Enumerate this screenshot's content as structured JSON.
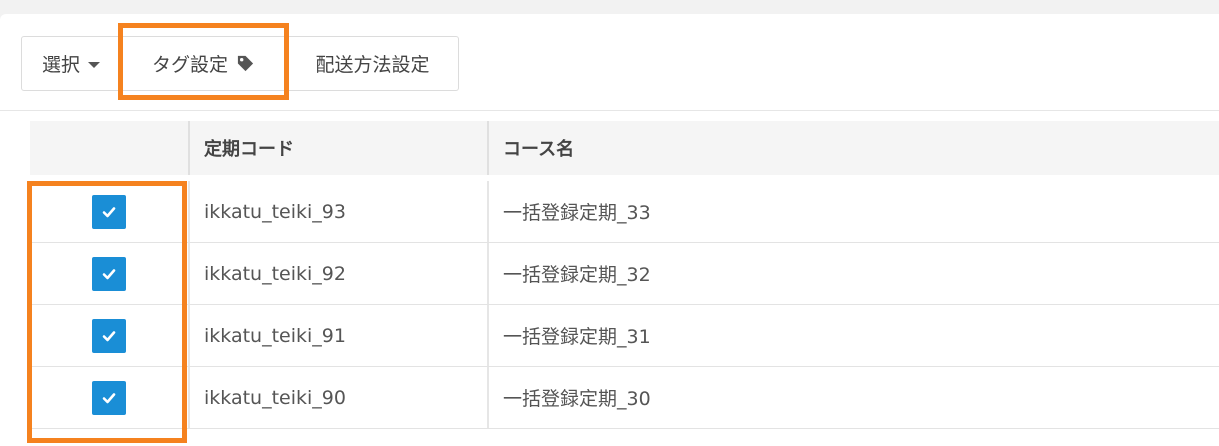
{
  "toolbar": {
    "select_label": "選択",
    "tag_label": "タグ設定",
    "shipping_label": "配送方法設定"
  },
  "table": {
    "headers": [
      "",
      "定期コード",
      "コース名"
    ],
    "rows": [
      {
        "checked": true,
        "code": "ikkatu_teiki_93",
        "name": "一括登録定期_33"
      },
      {
        "checked": true,
        "code": "ikkatu_teiki_92",
        "name": "一括登録定期_32"
      },
      {
        "checked": true,
        "code": "ikkatu_teiki_91",
        "name": "一括登録定期_31"
      },
      {
        "checked": true,
        "code": "ikkatu_teiki_90",
        "name": "一括登録定期_30"
      }
    ]
  },
  "colors": {
    "highlight": "#f5821f",
    "checkbox": "#1a8ed6"
  },
  "icons": [
    "chevron-down-icon",
    "tag-icon",
    "checkmark-icon"
  ]
}
